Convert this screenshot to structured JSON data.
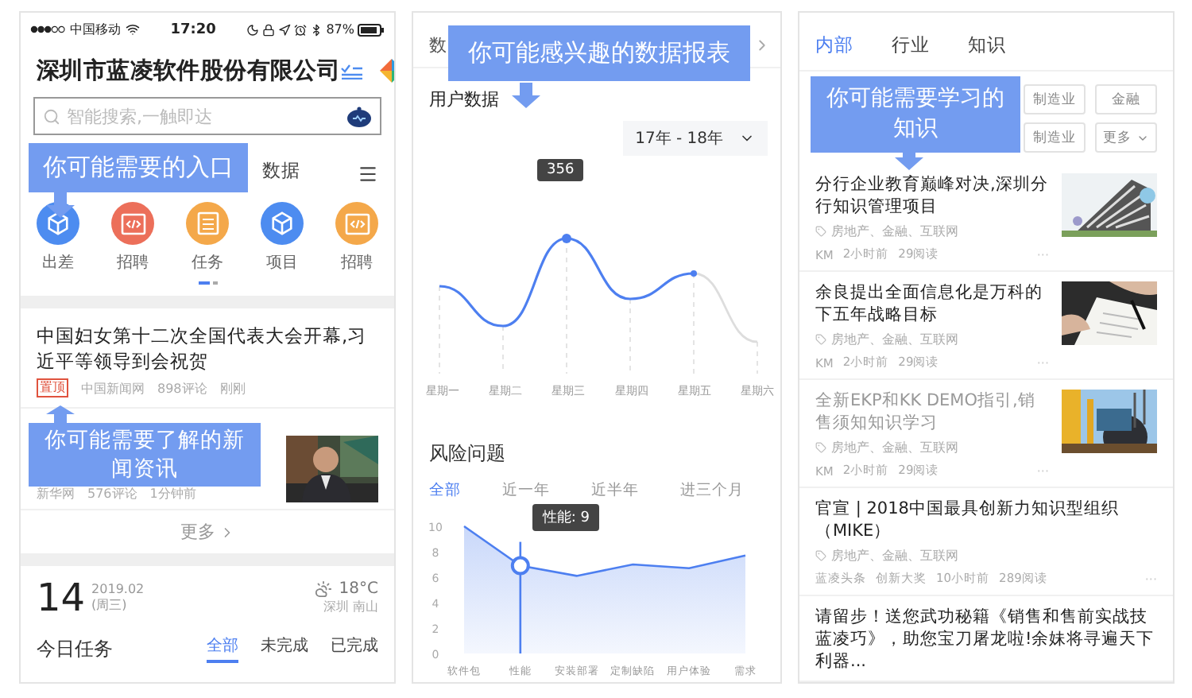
{
  "home": {
    "status_bar": {
      "carrier": "中国移动",
      "time": "17:20",
      "battery": "87%"
    },
    "title": "深圳市蓝凌软件股份有限公司",
    "search": {
      "placeholder": "智能搜索,一触即达"
    },
    "callouts": [
      {
        "text": "你可能需要的入口"
      },
      {
        "text": "你可能需要了解的新闻资讯"
      }
    ],
    "tabs": [
      {
        "label": "数据",
        "selected": false
      }
    ],
    "shortcuts": [
      {
        "label": "出差",
        "kind": "cube",
        "color": "#4d8cf0"
      },
      {
        "label": "招聘",
        "kind": "code",
        "color": "#ec6f5a"
      },
      {
        "label": "任务",
        "kind": "doc",
        "color": "#f4a84a"
      },
      {
        "label": "项目",
        "kind": "cube",
        "color": "#4d8cf0"
      },
      {
        "label": "招聘",
        "kind": "code",
        "color": "#f4a84a"
      }
    ],
    "pager": [
      {
        "selected": true
      },
      {
        "selected": false
      }
    ],
    "news": [
      {
        "kind": "text",
        "title": "中国妇女第十二次全国代表大会开幕,习近平等领导到会祝贺",
        "badge": "置顶",
        "source": "中国新闻网",
        "comments": "898评论",
        "time": "刚刚"
      },
      {
        "kind": "picture",
        "source": "新华网",
        "comments": "576评论",
        "time": "1分钟前"
      }
    ],
    "more": "更多",
    "date": {
      "day": "14",
      "month": "2019.02",
      "weekday": "(周三)"
    },
    "weather": {
      "temp": "18°C",
      "place": "深圳 南山"
    },
    "tasks": {
      "title": "今日任务",
      "tabs": [
        {
          "label": "全部",
          "selected": true
        },
        {
          "label": "未完成",
          "selected": false
        },
        {
          "label": "已完成",
          "selected": false
        }
      ]
    }
  },
  "reports": {
    "header": "数",
    "callout": {
      "text": "你可能感兴趣的数据报表"
    },
    "user_data": {
      "title": "用户数据",
      "range": "17年 - 18年",
      "tooltip": "356",
      "days": [
        "星期一",
        "星期二",
        "星期三",
        "星期四",
        "星期五",
        "星期六"
      ]
    },
    "risk": {
      "title": "风险问题",
      "tabs": [
        {
          "label": "全部",
          "selected": true
        },
        {
          "label": "近一年",
          "selected": false
        },
        {
          "label": "近半年",
          "selected": false
        },
        {
          "label": "进三个月",
          "selected": false
        }
      ],
      "chart_data": {
        "type": "area",
        "categories": [
          "软件包",
          "性能",
          "安装部署",
          "定制缺陷",
          "用户体验",
          "需求"
        ],
        "series": [
          {
            "color": "#4d7ff0",
            "values": [
              10,
              6.9,
              6.1,
              7,
              6.7,
              7.7
            ]
          }
        ],
        "ylim": [
          0,
          10
        ],
        "yticks": [
          0,
          2,
          4,
          6,
          8,
          10
        ],
        "annotations": [
          "性能: 9"
        ]
      }
    }
  },
  "knowledge": {
    "tabs": [
      {
        "label": "内部",
        "selected": true
      },
      {
        "label": "行业",
        "selected": false
      },
      {
        "label": "知识",
        "selected": false
      }
    ],
    "callout": {
      "text": "你可能需要学习的知识"
    },
    "filters": [
      {
        "label": "制造业",
        "kind": "chip"
      },
      {
        "label": "金融",
        "kind": "chip"
      },
      {
        "label": "制造业",
        "kind": "chip"
      },
      {
        "label": "更多",
        "kind": "dropdown"
      }
    ],
    "articles": [
      {
        "kind": "picture",
        "title": "分行企业教育巅峰对决,深圳分行知识管理项目",
        "read": false,
        "tags": "房地产、金融、互联网",
        "meta": [
          "KM",
          "2小时前",
          "29阅读"
        ],
        "menu": "···"
      },
      {
        "kind": "picture",
        "title": "余良提出全面信息化是万科的下五年战略目标",
        "read": false,
        "tags": "房地产、金融、互联网",
        "meta": [
          "KM",
          "2小时前",
          "29阅读"
        ],
        "menu": "···"
      },
      {
        "kind": "picture",
        "title": "全新EKP和KK DEMO指引,销售须知知识学习",
        "read": true,
        "tags": "房地产、金融、互联网",
        "meta": [
          "KM",
          "2小时前",
          "29阅读"
        ],
        "menu": "···"
      },
      {
        "kind": "text",
        "title": "官宣 | 2018中国最具创新力知识型组织（MIKE）",
        "read": false,
        "tags": "房地产、金融、互联网",
        "meta": [
          "蓝凌头条",
          "创新大奖",
          "10小时前",
          "289阅读"
        ],
        "menu": "···"
      },
      {
        "kind": "text",
        "title": "请留步！送您武功秘籍《销售和售前实战技蓝凌巧》，助您宝刀屠龙啦!余妹将寻遍天下利器...",
        "read": false
      }
    ]
  }
}
